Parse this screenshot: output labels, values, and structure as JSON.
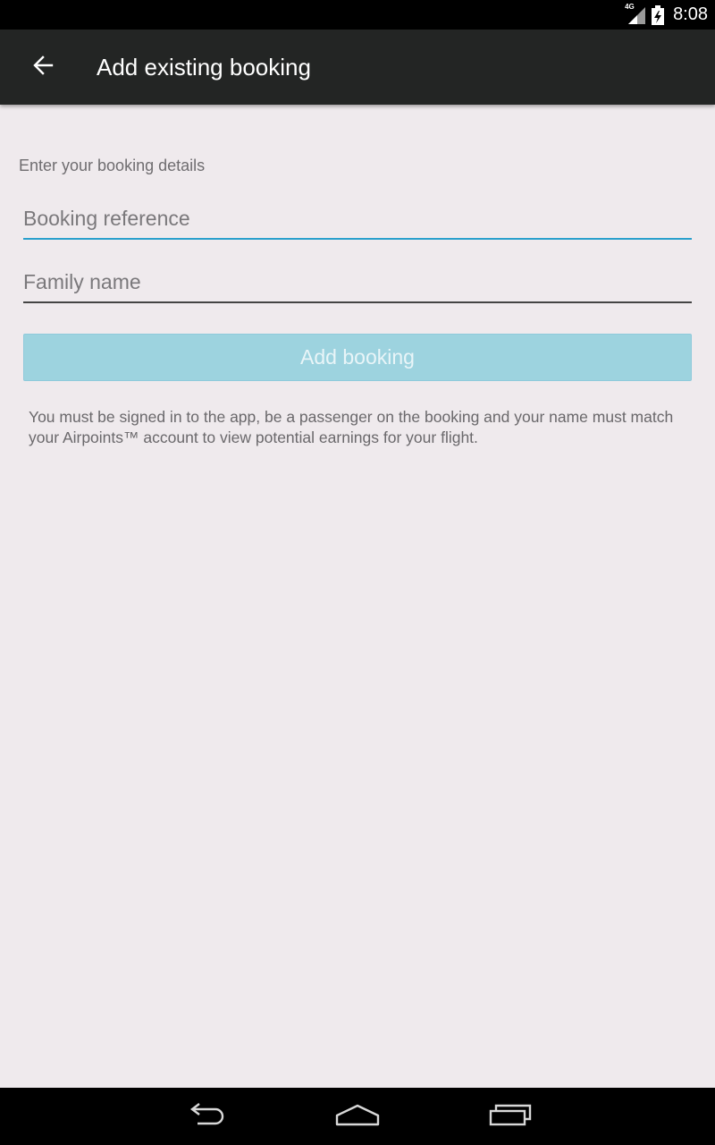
{
  "status_bar": {
    "network_label": "4G",
    "time": "8:08"
  },
  "app_bar": {
    "title": "Add existing booking"
  },
  "form": {
    "section_label": "Enter your booking details",
    "booking_reference": {
      "value": "",
      "placeholder": "Booking reference"
    },
    "family_name": {
      "value": "",
      "placeholder": "Family name"
    },
    "submit_label": "Add booking",
    "disclaimer": "You must be signed in to the app, be a passenger on the booking and your name must match your Airpoints™ account to view potential earnings for your flight."
  },
  "colors": {
    "app_bar_bg": "#232524",
    "page_bg": "#efeaed",
    "accent": "#2aa0cc",
    "button_disabled_bg": "#9dd3df"
  },
  "icons": {
    "back": "arrow-back-icon",
    "signal": "signal-icon",
    "battery": "battery-charging-icon",
    "nav_back": "nav-back-icon",
    "nav_home": "nav-home-icon",
    "nav_recents": "nav-recents-icon"
  }
}
